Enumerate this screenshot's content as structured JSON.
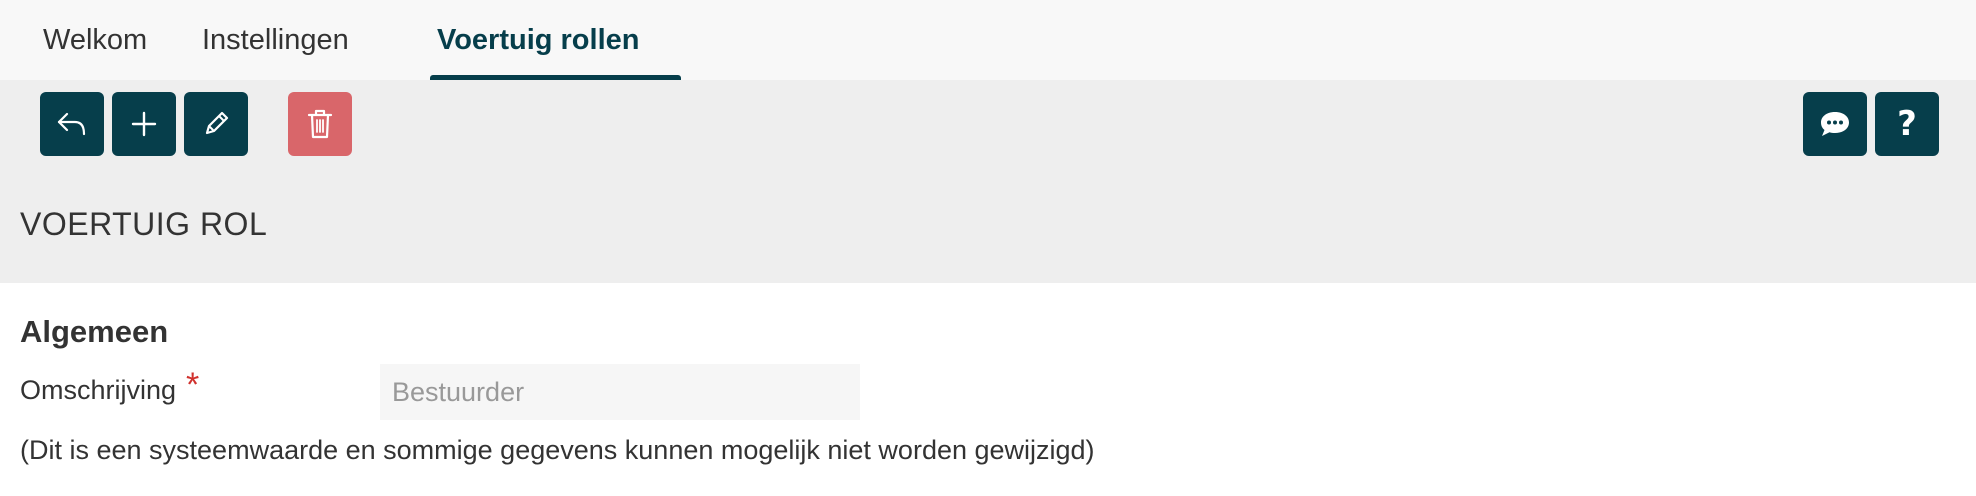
{
  "tabs": [
    {
      "label": "Welkom",
      "active": false
    },
    {
      "label": "Instellingen",
      "active": false
    },
    {
      "label": "Voertuig rollen",
      "active": true
    }
  ],
  "toolbar": {
    "left_buttons": [
      "back-icon",
      "plus-icon",
      "pencil-icon",
      "trash-icon"
    ],
    "right_buttons": [
      "chat-icon",
      "help-icon"
    ],
    "help_glyph": "?"
  },
  "page": {
    "title": "VOERTUIG ROL"
  },
  "form": {
    "section_title": "Algemeen",
    "fields": [
      {
        "label": "Omschrijving",
        "required_mark": "*",
        "value": "Bestuurder"
      }
    ],
    "note": "(Dit is een systeemwaarde en sommige gegevens kunnen mogelijk niet worden gewijzigd)"
  },
  "colors": {
    "primary": "#063e4b",
    "danger": "#d9666a",
    "panel": "#eeeeee",
    "required": "#d0312d"
  }
}
